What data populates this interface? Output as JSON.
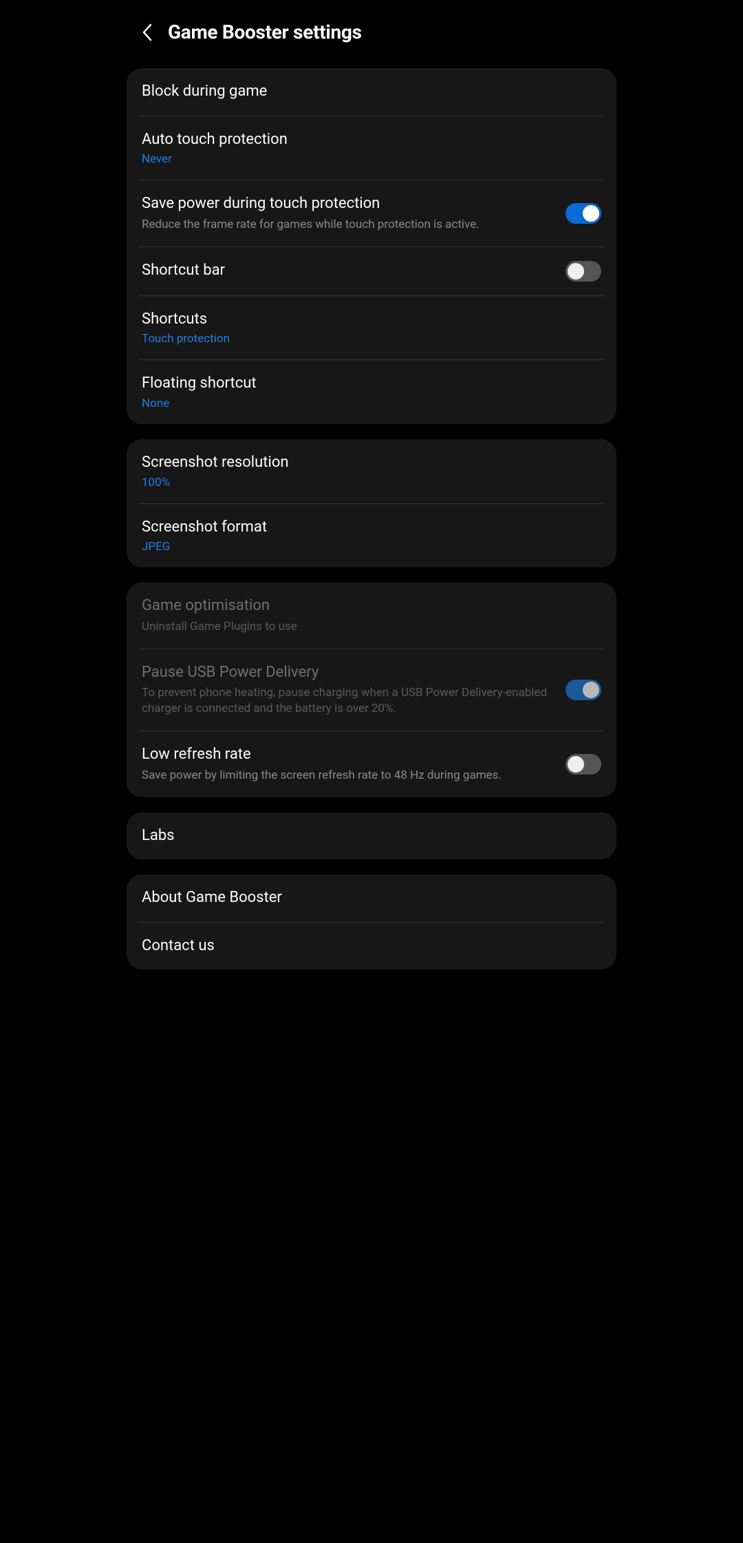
{
  "header": {
    "title": "Game Booster settings"
  },
  "group1": {
    "block_during_game": "Block during game",
    "auto_touch_protection": {
      "title": "Auto touch protection",
      "value": "Never"
    },
    "save_power": {
      "title": "Save power during touch protection",
      "subtitle": "Reduce the frame rate for games while touch protection is active.",
      "toggle": true
    },
    "shortcut_bar": {
      "title": "Shortcut bar",
      "toggle": false
    },
    "shortcuts": {
      "title": "Shortcuts",
      "value": "Touch protection"
    },
    "floating_shortcut": {
      "title": "Floating shortcut",
      "value": "None"
    }
  },
  "group2": {
    "screenshot_resolution": {
      "title": "Screenshot resolution",
      "value": "100%"
    },
    "screenshot_format": {
      "title": "Screenshot format",
      "value": "JPEG"
    }
  },
  "group3": {
    "game_optimisation": {
      "title": "Game optimisation",
      "subtitle": "Uninstall Game Plugins to use"
    },
    "pause_usb": {
      "title": "Pause USB Power Delivery",
      "subtitle": "To prevent phone heating, pause charging when a USB Power Delivery-enabled charger is connected and the battery is over 20%.",
      "toggle": true
    },
    "low_refresh": {
      "title": "Low refresh rate",
      "subtitle": "Save power by limiting the screen refresh rate to 48 Hz during games.",
      "toggle": false
    }
  },
  "group4": {
    "labs": "Labs"
  },
  "group5": {
    "about": "About Game Booster",
    "contact": "Contact us"
  }
}
